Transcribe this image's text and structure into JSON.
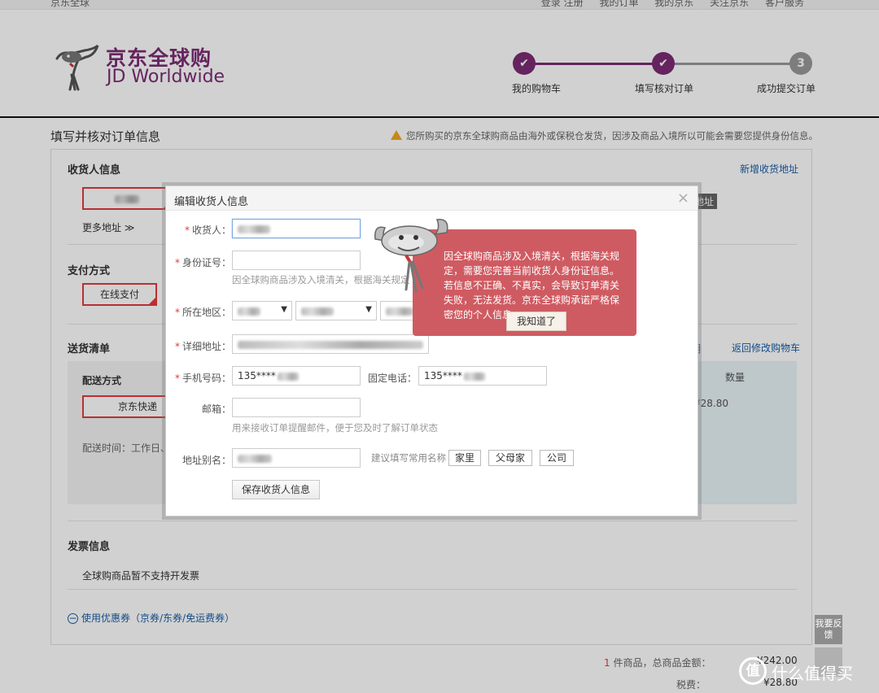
{
  "topbar": {
    "left": "京东全球",
    "links": [
      "登录 注册",
      "我的订单",
      "我的京东",
      "关注京东",
      "客户服务"
    ]
  },
  "header": {
    "logo_zh": "京东全球购",
    "logo_en": "JD Worldwide"
  },
  "steps": [
    {
      "label": "我的购物车",
      "mark": "✔",
      "state": "done"
    },
    {
      "label": "填写核对订单",
      "mark": "✔",
      "state": "done"
    },
    {
      "label": "成功提交订单",
      "mark": "3",
      "state": "todo"
    }
  ],
  "colors": {
    "accent": "#7c2b74",
    "red": "#e4393c",
    "tooltip": "#cf5b62",
    "link": "#1a5ea6"
  },
  "page": {
    "title": "填写并核对订单信息",
    "notice": "您所购买的京东全球购商品由海外或保税仓发货，因涉及商品入境所以可能会需要您提供身份信息。"
  },
  "receiver": {
    "title": "收货人信息",
    "add_link": "新增收货地址",
    "more": "更多地址",
    "tag": "地址"
  },
  "payment": {
    "title": "支付方式",
    "option": "在线支付"
  },
  "shipping": {
    "title": "送货清单",
    "explain_link": "明",
    "back_link": "返回修改购物车",
    "method_title": "配送方式",
    "carrier": "京东快递",
    "time_label": "配送时间：工作日、",
    "qty_label": "数量",
    "price": "¥28.80"
  },
  "invoice": {
    "title": "发票信息",
    "text": "全球购商品暂不支持开发票"
  },
  "coupon": {
    "label": "使用优惠券（京券/东券/免运费券）"
  },
  "summary": {
    "count": "1",
    "count_text": "件商品，总商品金额：",
    "total": "¥242.00",
    "tax_label": "税费：",
    "tax": "¥28.80"
  },
  "feedback": {
    "label": "我要反馈"
  },
  "watermark": {
    "circle": "值",
    "text": "什么值得买"
  },
  "modal": {
    "title": "编辑收货人信息",
    "close": "×",
    "fields": {
      "name_label": "收货人：",
      "id_label": "身份证号：",
      "id_hint": "因全球购商品涉及入境清关，根据海关规定",
      "region_label": "所在地区：",
      "district_placeholder": "城区",
      "address_label": "详细地址：",
      "mobile_label": "手机号码：",
      "mobile_value": "135****",
      "phone_label": "固定电话：",
      "phone_value": "135****",
      "email_label": "邮箱：",
      "email_hint": "用来接收订单提醒邮件，便于您及时了解订单状态",
      "alias_label": "地址别名：",
      "alias_hint": "建议填写常用名称",
      "alias_tags": [
        "家里",
        "父母家",
        "公司"
      ]
    },
    "save": "保存收货人信息"
  },
  "tooltip": {
    "text": "因全球购商品涉及入境清关，根据海关规定，需要您完善当前收货人身份证信息。若信息不正确、不真实，会导致订单清关失败，无法发货。京东全球购承诺严格保密您的个人信息。",
    "ok": "我知道了"
  }
}
